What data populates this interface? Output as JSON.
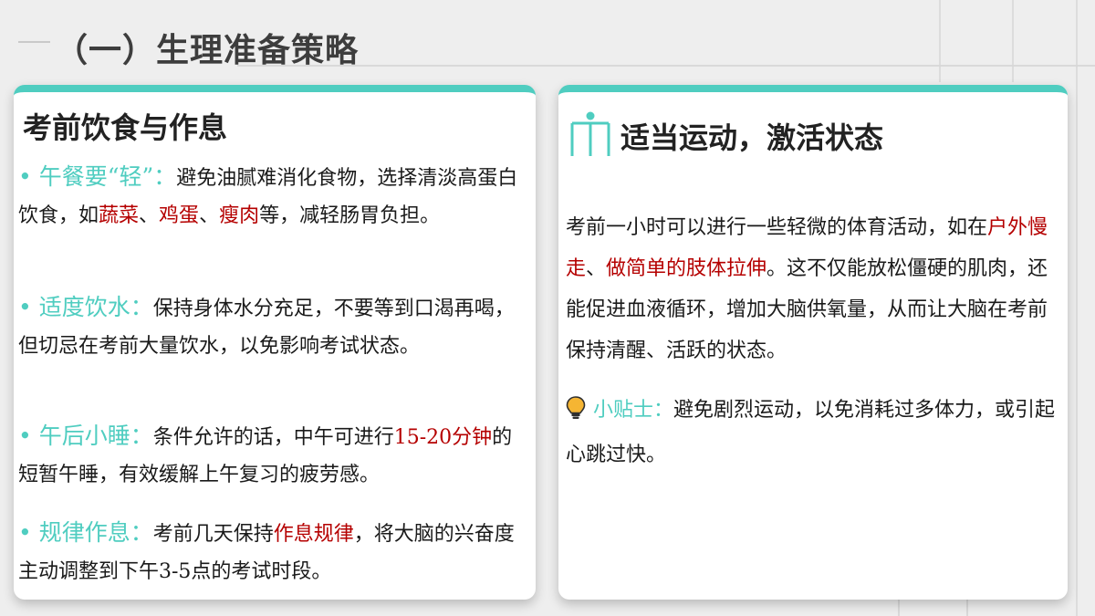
{
  "title": "（一）生理准备策略",
  "left_card": {
    "heading": "考前饮食与作息",
    "items": [
      {
        "label": "• 午餐要“轻”：",
        "segments": [
          {
            "text": "避免油腻难消化食物，选择清淡高蛋白饮食，如",
            "red": false
          },
          {
            "text": "蔬菜",
            "red": true
          },
          {
            "text": "、",
            "red": false
          },
          {
            "text": "鸡蛋",
            "red": true
          },
          {
            "text": "、",
            "red": false
          },
          {
            "text": "瘦肉",
            "red": true
          },
          {
            "text": "等，减轻肠胃负担。",
            "red": false
          }
        ]
      },
      {
        "label": "• 适度饮水：",
        "segments": [
          {
            "text": "保持身体水分充足，不要等到口渴再喝，但切忌在考前大量饮水，以免影响考试状态。",
            "red": false
          }
        ]
      },
      {
        "label": "• 午后小睡：",
        "segments": [
          {
            "text": "条件允许的话，中午可进行",
            "red": false
          },
          {
            "text": "15-20分钟",
            "red": true
          },
          {
            "text": "的短暂午睡，有效缓解上午复习的疲劳感。",
            "red": false
          }
        ]
      },
      {
        "label": "• 规律作息：",
        "segments": [
          {
            "text": "考前几天保持",
            "red": false
          },
          {
            "text": "作息规律",
            "red": true
          },
          {
            "text": "，将大脑的兴奋度主动调整到下午3-5点的考试时段。",
            "red": false
          }
        ]
      }
    ]
  },
  "right_card": {
    "heading": "适当运动，激活状态",
    "icon": "person-exercise-icon",
    "paragraph": [
      {
        "text": "考前一小时可以进行一些轻微的体育活动，如在",
        "red": false
      },
      {
        "text": "户外慢走",
        "red": true
      },
      {
        "text": "、",
        "red": false
      },
      {
        "text": "做简单的肢体拉伸",
        "red": true
      },
      {
        "text": "。这不仅能放松僵硬的肌肉，还能促进血液循环，增加大脑供氧量，从而让大脑在考前保持清醒、活跃的状态。",
        "red": false
      }
    ],
    "tip": {
      "icon": "lightbulb-icon",
      "label": "小贴士：",
      "text": "避免剧烈运动，以免消耗过多体力，或引起心跳过快。"
    }
  },
  "colors": {
    "accent": "#4fcdc0",
    "highlight": "#b50000",
    "title": "#3d3d3d"
  }
}
